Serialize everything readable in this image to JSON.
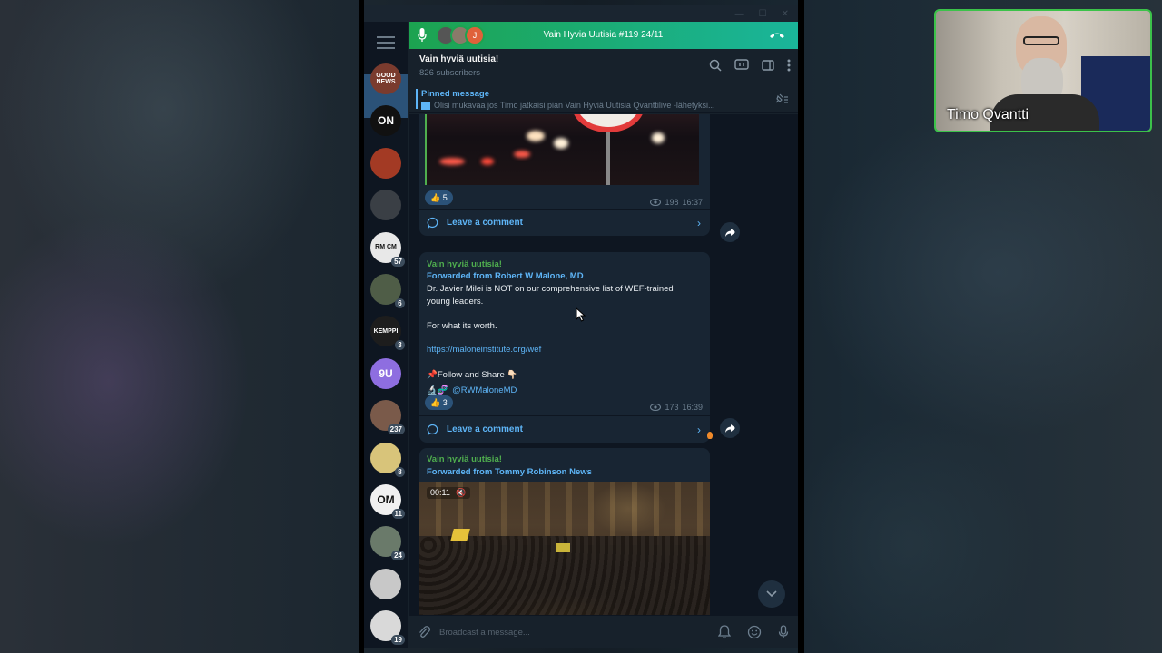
{
  "call": {
    "title": "Vain Hyvia Uutisia #119 24/11",
    "participant_initial": "J"
  },
  "channel": {
    "name": "Vain hyviä uutisia!",
    "subscribers": "826 subscribers"
  },
  "pinned": {
    "title": "Pinned message",
    "text": "Olisi mukavaa jos Timo jatkaisi pian Vain Hyviä Uutisia Qvanttilive -lähetyksi..."
  },
  "sidebar": {
    "chats": [
      {
        "label": "GOOD NEWS",
        "badge": "",
        "color": "#7a3b2e"
      },
      {
        "label": "ON",
        "badge": "",
        "color": "#111111"
      },
      {
        "label": "",
        "badge": "",
        "color": "#a33a24"
      },
      {
        "label": "",
        "badge": "",
        "color": "#3a3f45"
      },
      {
        "label": "RM CM",
        "badge": "57",
        "color": "#e8e8e8"
      },
      {
        "label": "",
        "badge": "6",
        "color": "#4f5d47"
      },
      {
        "label": "KEMPPI",
        "badge": "3",
        "color": "#1d1d1d"
      },
      {
        "label": "9U",
        "badge": "",
        "color": "#8e6ee0"
      },
      {
        "label": "",
        "badge": "237",
        "color": "#7a5a4a"
      },
      {
        "label": "",
        "badge": "8",
        "color": "#d8c47a"
      },
      {
        "label": "OM",
        "badge": "11",
        "color": "#f0f0f0"
      },
      {
        "label": "",
        "badge": "24",
        "color": "#6a7a6a"
      },
      {
        "label": "",
        "badge": "",
        "color": "#c8c8c8"
      },
      {
        "label": "",
        "badge": "19",
        "color": "#d9d9d9"
      }
    ]
  },
  "messages": {
    "m1": {
      "reaction": "👍 5",
      "views": "198",
      "time": "16:37",
      "comment_label": "Leave a comment"
    },
    "m2": {
      "author": "Vain hyviä uutisia!",
      "forwarded": "Forwarded from Robert W Malone, MD",
      "text1": "Dr. Javier Milei is NOT on our comprehensive list of WEF-trained young leaders.",
      "text2": "For what its worth.",
      "link": "https://maloneinstitute.org/wef",
      "follow": "📌Follow and Share 👇🏻",
      "handle_prefix": "🔬🧬",
      "handle": "@RWMaloneMD",
      "reaction": "👍 3",
      "views": "173",
      "time": "16:39",
      "comment_label": "Leave a comment"
    },
    "m3": {
      "author": "Vain hyviä uutisia!",
      "forwarded": "Forwarded from Tommy Robinson News",
      "video_time": "00:11"
    }
  },
  "composer": {
    "placeholder": "Broadcast a message..."
  },
  "webcam": {
    "name": "Timo Qvantti"
  }
}
